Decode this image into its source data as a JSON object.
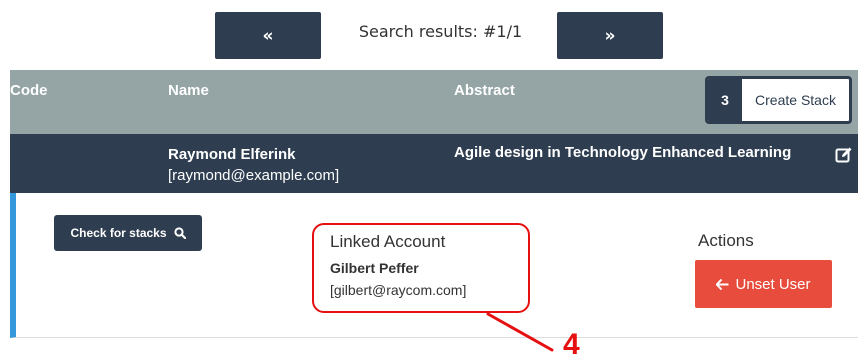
{
  "pager": {
    "prev_label": "«",
    "next_label": "»",
    "status_text": "Search results:  #1/1"
  },
  "table": {
    "headers": {
      "code": "Code",
      "name": "Name",
      "abstract": "Abstract"
    },
    "create_stack": {
      "count": "3",
      "label": "Create Stack"
    },
    "row": {
      "name": "Raymond Elferink",
      "email": "[raymond@example.com]",
      "abstract": "Agile design in Technology Enhanced Learning"
    }
  },
  "detail": {
    "check_stacks_label": "Check for stacks",
    "linked_account": {
      "title": "Linked Account",
      "name": "Gilbert Peffer",
      "email": "[gilbert@raycom.com]"
    },
    "actions_title": "Actions",
    "unset_user_label": "Unset User"
  },
  "annotation": {
    "number": "4"
  },
  "colors": {
    "dark_navy": "#2e3e50",
    "header_gray": "#95a5a5",
    "accent_blue": "#3498db",
    "danger_red": "#e74c3c",
    "annotation_red": "#e61010"
  },
  "icons": {
    "prev": "double-left-arrow-icon",
    "next": "double-right-arrow-icon",
    "edit": "edit-icon",
    "search": "search-icon",
    "back_arrow": "arrow-left-icon"
  }
}
